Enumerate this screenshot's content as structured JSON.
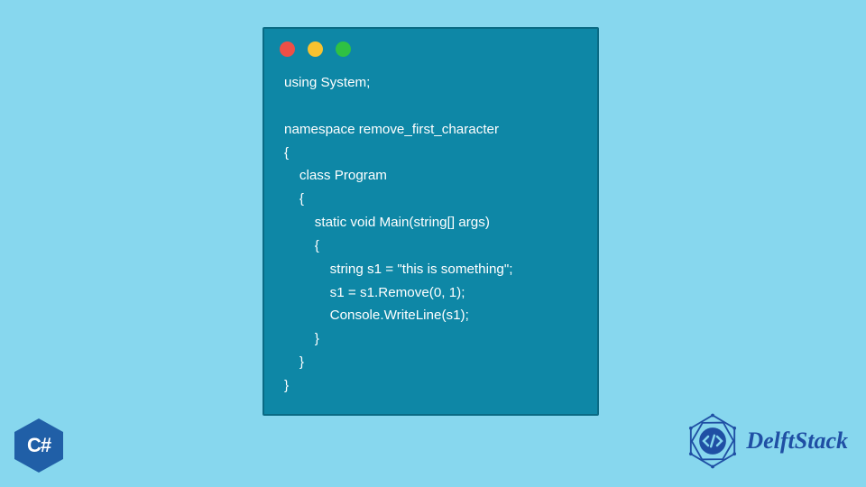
{
  "code_window": {
    "traffic_lights": [
      "red",
      "yellow",
      "green"
    ],
    "lines": [
      "using System;",
      "",
      "namespace remove_first_character",
      "{",
      "    class Program",
      "    {",
      "        static void Main(string[] args)",
      "        {",
      "            string s1 = \"this is something\";",
      "            s1 = s1.Remove(0, 1);",
      "            Console.WriteLine(s1);",
      "        }",
      "    }",
      "}"
    ]
  },
  "csharp_logo": {
    "label": "C#"
  },
  "delftstack": {
    "label": "DelftStack"
  }
}
